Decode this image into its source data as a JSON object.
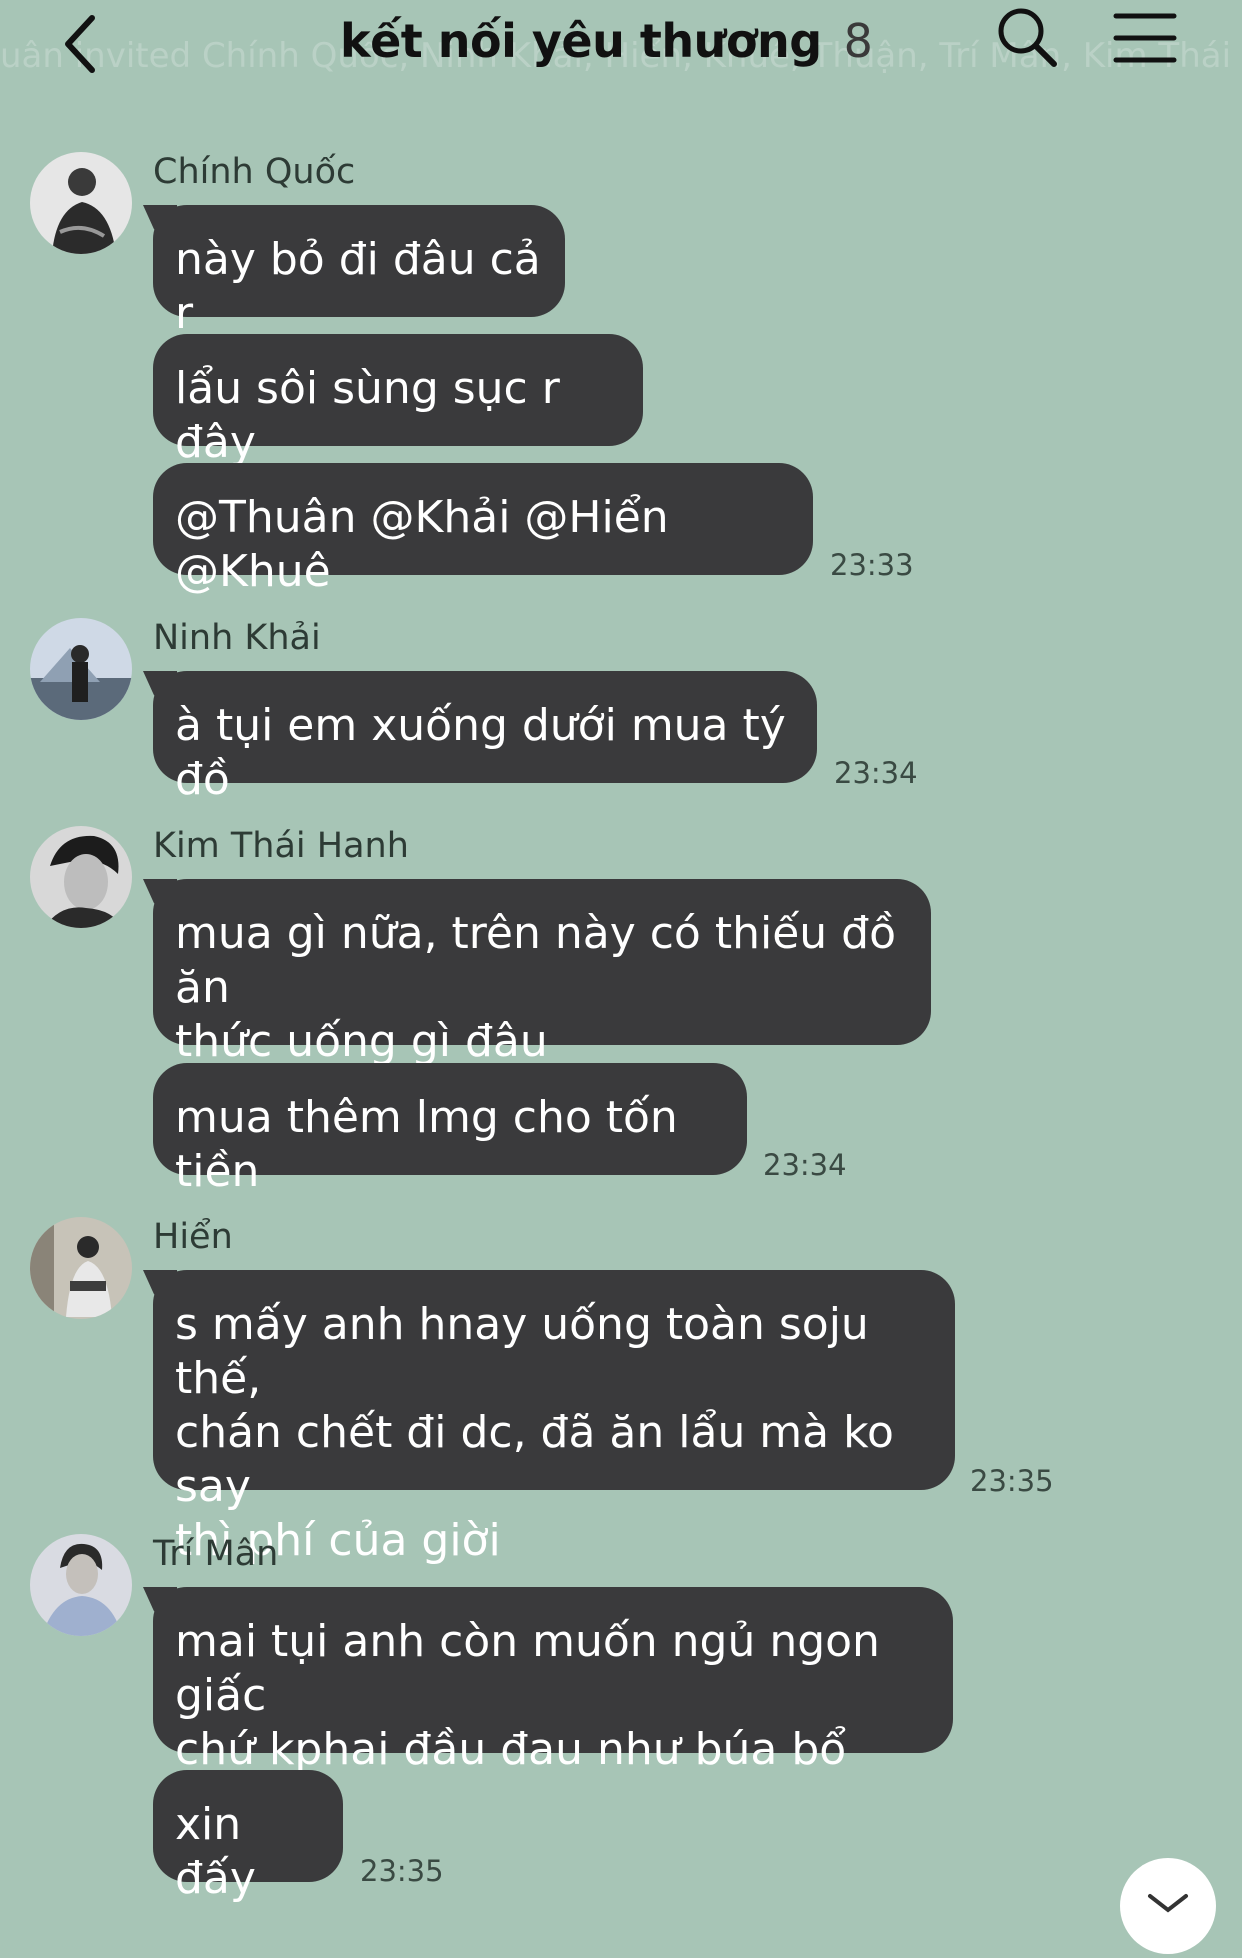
{
  "header": {
    "title": "kết nối yêu thương",
    "member_count": "8",
    "ghost_text": "uân invited Chính Quốc, Ninh Khải, Hiển, Khuê, Thuận, Trí Mân, Kim Thái Hanh and"
  },
  "colors": {
    "background": "#a7c5b6",
    "bubble": "#3a3a3c",
    "bubble_text": "#ffffff"
  },
  "groups": [
    {
      "sender": "Chính Quốc",
      "avatar_icon": "avatar-photo-chinh-quoc",
      "messages": [
        "này bỏ đi đâu cả r",
        "lẩu sôi sùng sục r đây",
        "@Thuân @Khải @Hiển @Khuê"
      ],
      "time": "23:33"
    },
    {
      "sender": "Ninh Khải",
      "avatar_icon": "avatar-photo-ninh-khai",
      "messages": [
        "à tụi em xuống dưới mua tý đồ"
      ],
      "time": "23:34"
    },
    {
      "sender": "Kim Thái Hanh",
      "avatar_icon": "avatar-photo-kim-thai-hanh",
      "messages": [
        "mua gì nữa, trên này có thiếu đồ ăn\nthức uống gì đâu",
        "mua thêm lmg cho tốn tiền"
      ],
      "time": "23:34"
    },
    {
      "sender": "Hiển",
      "avatar_icon": "avatar-photo-hien",
      "messages": [
        "s mấy anh hnay uống toàn soju thế,\nchán chết đi dc, đã ăn lẩu mà ko say\nthì phí của giời"
      ],
      "time": "23:35"
    },
    {
      "sender": "Trí Mân",
      "avatar_icon": "avatar-photo-tri-man",
      "messages": [
        "mai tụi anh còn muốn ngủ ngon giấc\nchứ kphai đầu đau như búa bổ",
        "xin đấy"
      ],
      "time": "23:35"
    }
  ]
}
